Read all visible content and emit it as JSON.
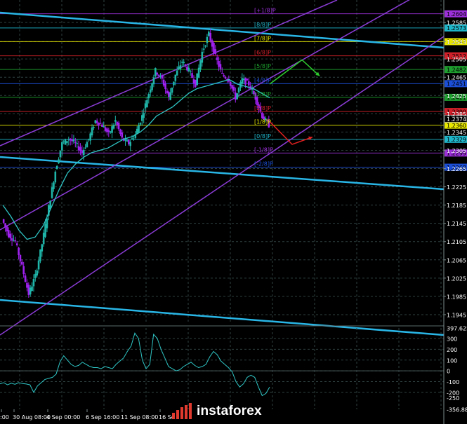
{
  "chart_data": [
    {
      "type": "candlestick",
      "instrument_panel": "main",
      "ylim": [
        1.1925,
        1.2625
      ],
      "y_ticks": [
        "1.2585",
        "1.2543",
        "1.2505",
        "1.2465",
        "1.2425",
        "1.2385",
        "1.2345",
        "1.2305",
        "1.2265",
        "1.2225",
        "1.2185",
        "1.2145",
        "1.2105",
        "1.2065",
        "1.2025",
        "1.1985",
        "1.1945"
      ],
      "price_values": [
        1.2154,
        1.212,
        1.2105,
        1.205,
        1.199,
        1.203,
        1.21,
        1.218,
        1.226,
        1.232,
        1.233,
        1.232,
        1.23,
        1.233,
        1.237,
        1.236,
        1.234,
        1.237,
        1.233,
        1.232,
        1.234,
        1.238,
        1.243,
        1.248,
        1.246,
        1.242,
        1.247,
        1.25,
        1.248,
        1.245,
        1.252,
        1.256,
        1.251,
        1.247,
        1.246,
        1.242,
        1.246,
        1.245,
        1.242,
        1.238,
        1.236
      ],
      "ma_values": [
        1.2185,
        1.216,
        1.213,
        1.211,
        1.2115,
        1.214,
        1.218,
        1.222,
        1.2255,
        1.2275,
        1.229,
        1.23,
        1.2305,
        1.231,
        1.232,
        1.233,
        1.2335,
        1.2345,
        1.236,
        1.238,
        1.239,
        1.24,
        1.2415,
        1.243,
        1.244,
        1.2445,
        1.245,
        1.2455,
        1.246,
        1.245,
        1.2445,
        1.244,
        1.243,
        1.242
      ],
      "murrey_levels": [
        {
          "label": "[+1/8]P",
          "price": 1.2604,
          "color": "#9b30d9",
          "price_label": "1.2604"
        },
        {
          "label": "[8/8]P",
          "price": 1.2573,
          "color": "#1fb5c9",
          "price_label": "1.2573"
        },
        {
          "label": "[7/8]P",
          "price": 1.2543,
          "color": "#e6e600",
          "price_label": "1.2543"
        },
        {
          "label": "[6/8]P",
          "price": 1.2512,
          "color": "#d0202a",
          "price_label": "1.2512"
        },
        {
          "label": "[5/8]P",
          "price": 1.2482,
          "color": "#1e9e2e",
          "price_label": "1.2482"
        },
        {
          "label": "[4/8]P",
          "price": 1.2451,
          "color": "#1c4fd8",
          "price_label": "1.2451"
        },
        {
          "label": "[3/8]P",
          "price": 1.2421,
          "color": "#1e9e2e",
          "price_label": "1.2421"
        },
        {
          "label": "[2/8]P",
          "price": 1.239,
          "color": "#d0202a",
          "price_label": "1.2390"
        },
        {
          "label": "[1/8]P",
          "price": 1.236,
          "color": "#e6e600",
          "price_label": "1.2360"
        },
        {
          "label": "[0/8]P",
          "price": 1.2329,
          "color": "#1fb5c9",
          "price_label": "1.2329"
        },
        {
          "label": "[-1/8]P",
          "price": 1.2299,
          "color": "#9b30d9",
          "price_label": "1.2299"
        },
        {
          "label": "[-2/8]P",
          "price": 1.2268,
          "color": "#1c4fd8",
          "price_label": "1.2268"
        }
      ],
      "current_price": "1.2374",
      "forecast": {
        "up": "green",
        "down": "red"
      }
    },
    {
      "type": "line",
      "instrument_panel": "oscillator",
      "ylim": [
        -356.8851,
        397.6254
      ],
      "y_ticks": [
        "397.6254",
        "300",
        "200",
        "100",
        "0",
        "-100",
        "-200",
        "-250",
        "-356.8851"
      ],
      "values": [
        -120,
        -110,
        -130,
        -115,
        -125,
        -110,
        -118,
        -122,
        -130,
        -200,
        -140,
        -110,
        -80,
        -70,
        -60,
        -30,
        80,
        140,
        100,
        60,
        40,
        50,
        80,
        60,
        40,
        30,
        30,
        20,
        40,
        30,
        20,
        60,
        90,
        120,
        180,
        230,
        350,
        300,
        100,
        20,
        60,
        340,
        300,
        200,
        120,
        40,
        20,
        0,
        10,
        40,
        60,
        80,
        50,
        30,
        40,
        60,
        130,
        180,
        150,
        90,
        60,
        30,
        -10,
        -100,
        -150,
        -120,
        -60,
        -40,
        -60,
        -150,
        -230,
        -210,
        -150
      ],
      "zero_line": 0
    }
  ],
  "x_axis_labels": [
    ":00",
    "30 Aug 08:00",
    "4 Sep 00:00",
    "6 Sep 16:00",
    "11 Sep 08:00",
    "16 Se"
  ],
  "watermark": "instaforex",
  "colors": {
    "background": "#000000",
    "grid": "#2f3f3f",
    "bull": "#1fb5a8",
    "bear": "#a020f0",
    "ma": "#2fc4c4",
    "channel_blue": "#29b6e6",
    "channel_purple": "#8b3cd6",
    "axis_text": "#ffffff"
  }
}
